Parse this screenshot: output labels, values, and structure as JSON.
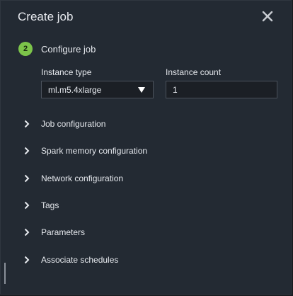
{
  "dialog": {
    "title": "Create job",
    "close_icon": "close-icon"
  },
  "step": {
    "number": "2",
    "label": "Configure job",
    "badge_color": "#7cc44a"
  },
  "fields": {
    "instance_type": {
      "label": "Instance type",
      "value": "ml.m5.4xlarge"
    },
    "instance_count": {
      "label": "Instance count",
      "value": "1"
    }
  },
  "sections": [
    {
      "label": "Job configuration"
    },
    {
      "label": "Spark memory configuration"
    },
    {
      "label": "Network configuration"
    },
    {
      "label": "Tags"
    },
    {
      "label": "Parameters"
    },
    {
      "label": "Associate schedules"
    }
  ]
}
